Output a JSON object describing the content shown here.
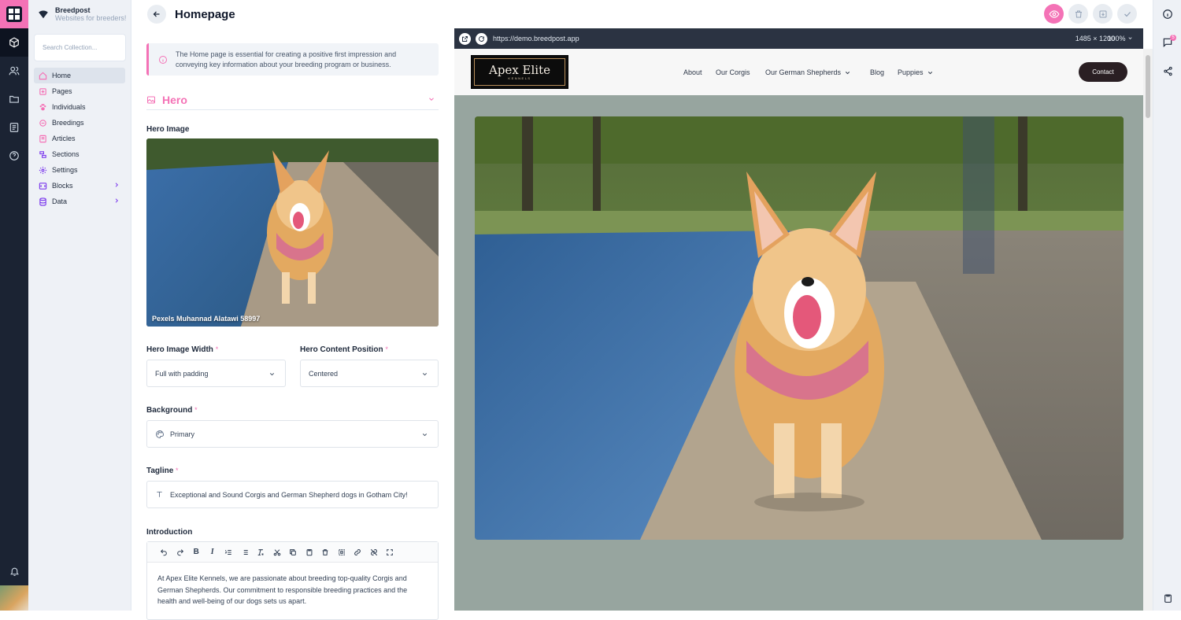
{
  "brand": {
    "name": "Breedpost",
    "tagline": "Websites for breeders!"
  },
  "search": {
    "placeholder": "Search Collection..."
  },
  "sidebar": {
    "items": [
      {
        "label": "Home",
        "icon": "home-icon"
      },
      {
        "label": "Pages",
        "icon": "pages-icon"
      },
      {
        "label": "Individuals",
        "icon": "paw-icon"
      },
      {
        "label": "Breedings",
        "icon": "breedings-icon"
      },
      {
        "label": "Articles",
        "icon": "articles-icon"
      },
      {
        "label": "Sections",
        "icon": "sections-icon"
      },
      {
        "label": "Settings",
        "icon": "gear-icon"
      },
      {
        "label": "Blocks",
        "icon": "blocks-icon"
      },
      {
        "label": "Data",
        "icon": "database-icon"
      }
    ]
  },
  "editor": {
    "title": "Homepage",
    "info": "The Home page is essential for creating a positive first impression and conveying key information about your breeding program or business.",
    "section_title": "Hero",
    "hero_image_label": "Hero Image",
    "hero_image_caption": "Pexels Muhannad Alatawi 58997",
    "hero_width_label": "Hero Image Width",
    "hero_width_value": "Full with padding",
    "hero_position_label": "Hero Content Position",
    "hero_position_value": "Centered",
    "background_label": "Background",
    "background_value": "Primary",
    "tagline_label": "Tagline",
    "tagline_value": "Exceptional and Sound Corgis and German Shepherd dogs in Gotham City!",
    "introduction_label": "Introduction",
    "introduction_text": "At Apex Elite Kennels, we are passionate about breeding top-quality Corgis and German Shepherds. Our commitment to responsible breeding practices and the health and well-being of our dogs sets us apart.",
    "required_mark": "*"
  },
  "preview": {
    "url": "https://demo.breedpost.app",
    "dimensions": "1485 × 1200",
    "zoom": "100%",
    "site": {
      "logo_name": "Apex Elite",
      "logo_sub": "KENNELS",
      "nav": [
        "About",
        "Our Corgis",
        "Our German Shepherds",
        "Blog",
        "Puppies"
      ],
      "contact": "Contact"
    }
  },
  "rail_badge": "5",
  "colors": {
    "accent": "#f472b6",
    "rail": "#1b2333",
    "preview_bg": "#97a59f"
  }
}
